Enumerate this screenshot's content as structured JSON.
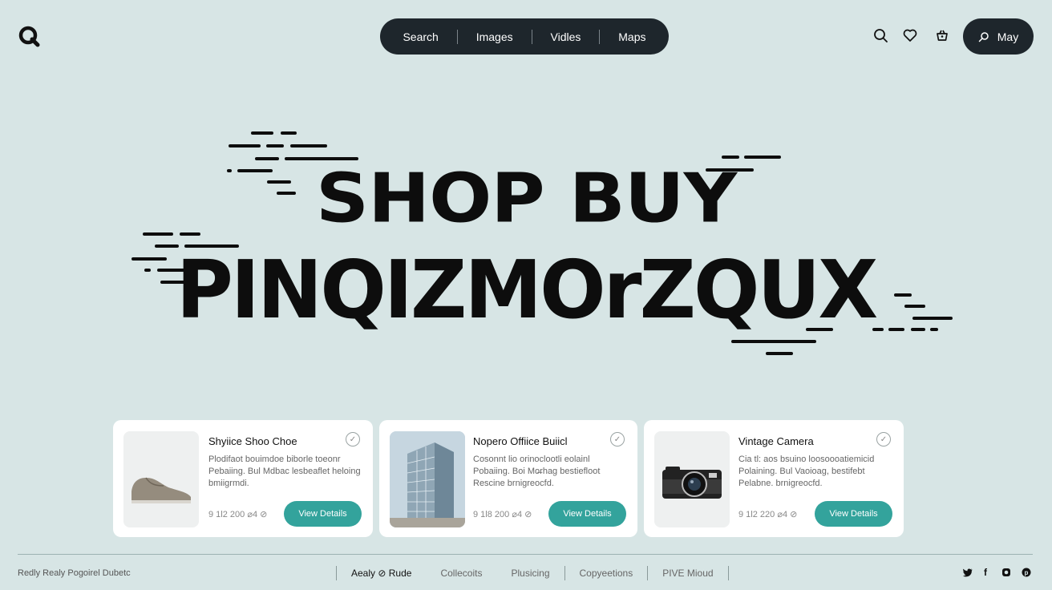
{
  "nav": {
    "items": [
      "Search",
      "Images",
      "Vidles",
      "Maps"
    ],
    "user_label": "May"
  },
  "icons": {
    "logo": "q-logo-icon",
    "top": [
      "search-icon",
      "heart-icon",
      "basket-icon"
    ],
    "social": [
      "twitter-icon",
      "facebook-icon",
      "instagram-icon",
      "pinterest-icon"
    ]
  },
  "hero": {
    "line1": "SHOP BUY",
    "line2": "PINQIZMOrZQUX"
  },
  "cards": [
    {
      "title": "Shyiice Shoo Choe",
      "desc": "Plodifaot bouimdoe biborle toeonr Pebaiing. Bul Mdbac lesbeaflet heloing bmiigrmdi.",
      "price": "9 1l2 200 ⌀4 ⊘",
      "button": "View Details",
      "image": "shoe"
    },
    {
      "title": "Nopero Offiice Buiicl",
      "desc": "Cosonnt lio orinoclootli eolainl Pobaiing. Boi Mo̶rhag bestiefloot Rescine brnigreocfd.",
      "price": "9 1l8 200 ⌀4 ⊘",
      "button": "View Details",
      "image": "building"
    },
    {
      "title": "Vintage Camera",
      "desc": "Cia tl: aos bsuino loosoooatiemicid Polaining. Bul Vaoioag, bestifebt Pelabne. brnigreocfd.",
      "price": "9 1l2 220 ⌀4 ⊘",
      "button": "View Details",
      "image": "camera"
    }
  ],
  "footer": {
    "left_text": "Redly Realy Pogoirel Dubetc",
    "links": [
      "Aealy ⊘ Rude",
      "Collecoits",
      "Plusicing",
      "Copyeetions",
      "PIVE Mioud"
    ]
  },
  "colors": {
    "background": "#d7e5e5",
    "pill": "#1e262c",
    "accent": "#33a39c"
  }
}
